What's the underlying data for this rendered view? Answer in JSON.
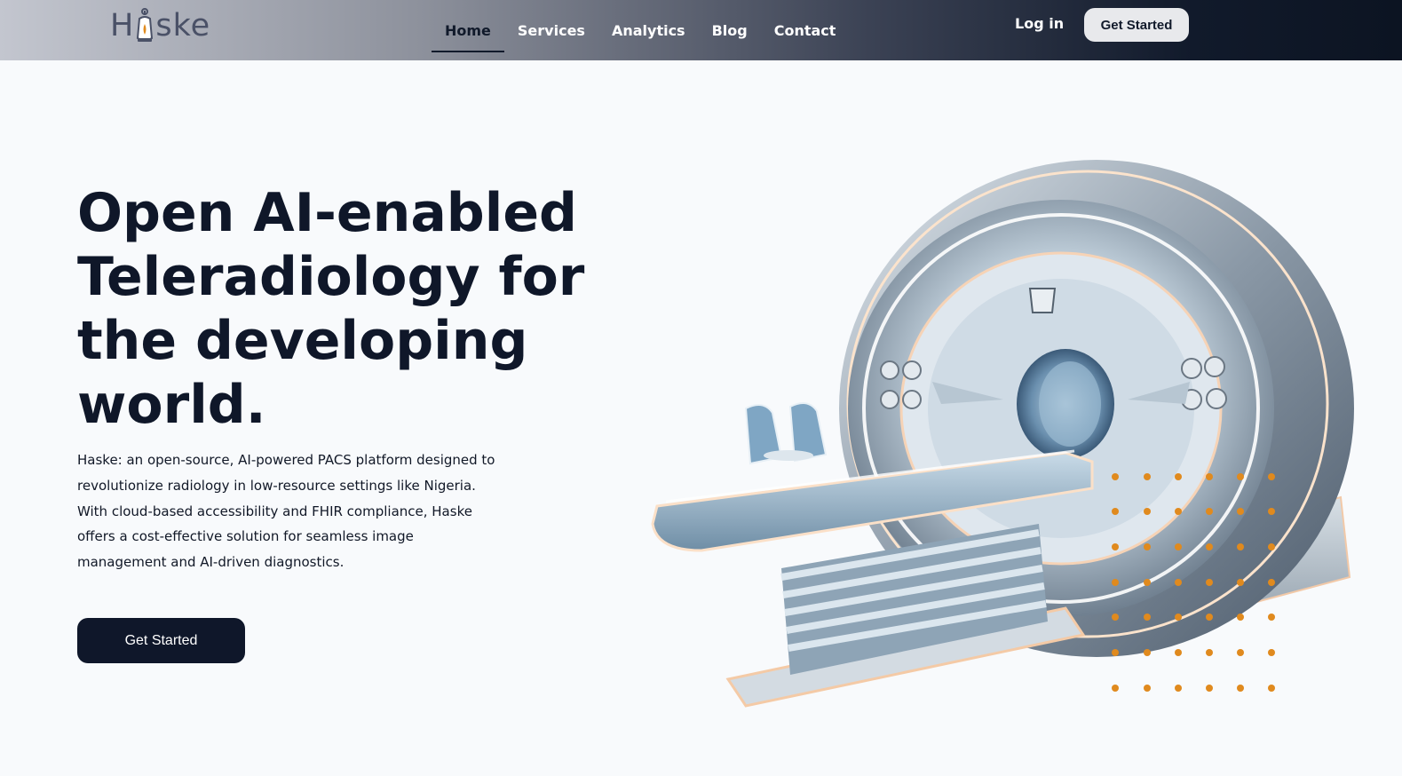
{
  "brand": {
    "name": "Haske",
    "logo_prefix": "H",
    "logo_suffix": "ske"
  },
  "nav": {
    "items": [
      {
        "label": "Home",
        "active": true
      },
      {
        "label": "Services",
        "active": false
      },
      {
        "label": "Analytics",
        "active": false
      },
      {
        "label": "Blog",
        "active": false
      },
      {
        "label": "Contact",
        "active": false
      }
    ],
    "login_label": "Log in",
    "cta_label": "Get Started"
  },
  "hero": {
    "title": "Open AI-enabled Teleradiology for the developing world.",
    "description": "Haske: an open-source, AI-powered PACS platform designed to revolutionize radiology in low-resource settings like Nigeria. With cloud-based accessibility and FHIR compliance, Haske offers a cost-effective solution for seamless image management and AI-driven diagnostics.",
    "cta_label": "Get Started",
    "image_icon": "mri-scanner-illustration"
  },
  "colors": {
    "navy": "#0f172a",
    "accent_orange": "#e08a1e",
    "background": "#f8fafc"
  }
}
